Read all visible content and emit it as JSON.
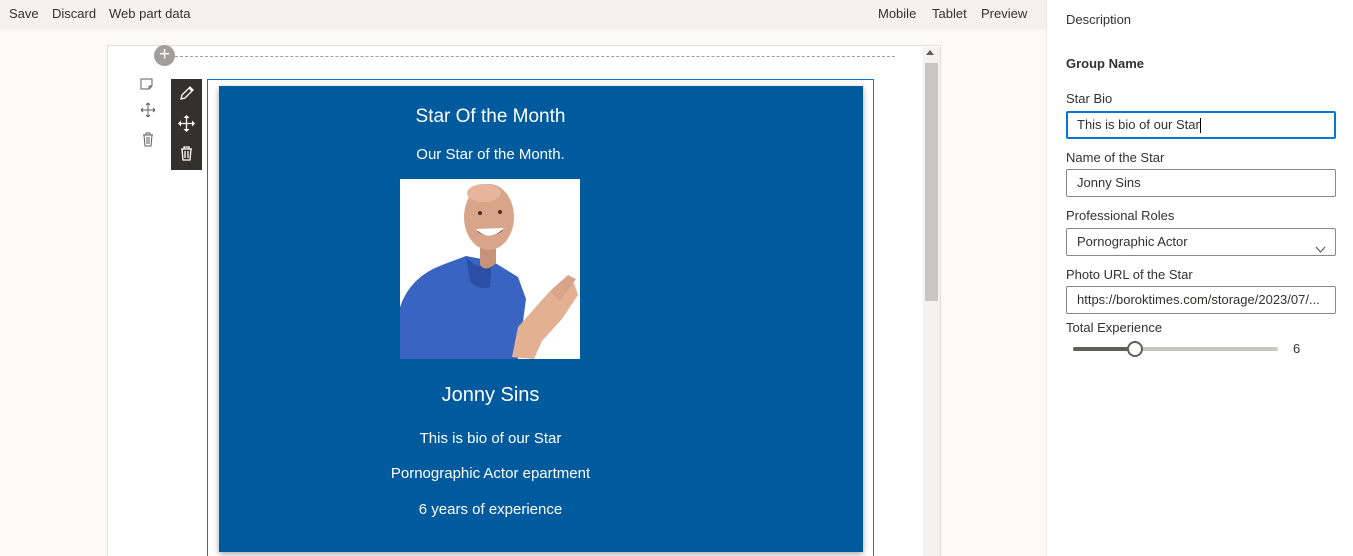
{
  "toolbar": {
    "save": "Save",
    "discard": "Discard",
    "web_part_data": "Web part data",
    "mobile": "Mobile",
    "tablet": "Tablet",
    "preview": "Preview"
  },
  "canvas": {
    "add_section_icon": "plus-circle-icon",
    "section_tool_icons": [
      "edit-section-icon",
      "move-icon",
      "delete-icon"
    ],
    "webpart_tool_icons": [
      "pencil-icon",
      "move-icon",
      "delete-icon"
    ]
  },
  "card": {
    "title": "Star Of the Month",
    "subtitle": "Our Star of the Month.",
    "photo": "star-photo",
    "name": "Jonny Sins",
    "bio": "This is bio of our Star",
    "role_line": "Pornographic Actor epartment",
    "experience_line": "6 years of experience",
    "background_color": "#005a9e"
  },
  "pane": {
    "description": "Description",
    "group_name": "Group Name",
    "star_bio_label": "Star Bio",
    "star_bio_value": "This is bio of our Star",
    "name_label": "Name of the Star",
    "name_value": "Jonny Sins",
    "roles_label": "Professional Roles",
    "roles_value": "Pornographic Actor",
    "photo_label": "Photo URL of the Star",
    "photo_value": "https://boroktimes.com/storage/2023/07/...",
    "experience_label": "Total Experience",
    "experience_value": "6",
    "experience_fraction": 0.3
  },
  "colors": {
    "accent": "#0078d4",
    "card": "#005a9e",
    "command_bar": "#f3f2f1"
  }
}
